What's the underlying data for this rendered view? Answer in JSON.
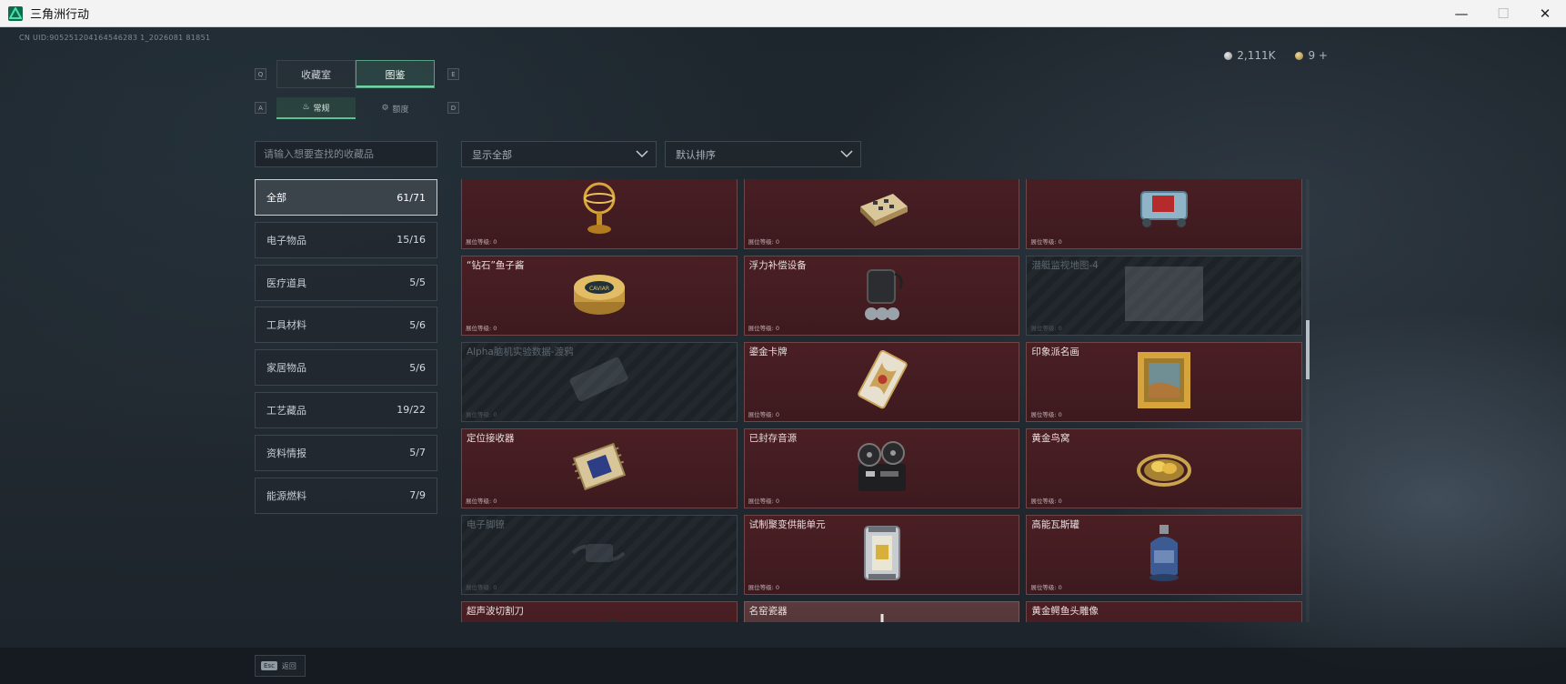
{
  "window": {
    "title": "三角洲行动",
    "minimize": "—",
    "maximize": "☐",
    "close": "✕"
  },
  "header": {
    "uid": "CN UID:905251204164546283 1_2026081 81851"
  },
  "currency": [
    {
      "icon": "silver-coin-icon",
      "value": "2,111K"
    },
    {
      "icon": "gold-coin-icon",
      "value": "9 +"
    }
  ],
  "tabs": {
    "key_left": "Q",
    "key_right": "E",
    "items": [
      {
        "label": "收藏室"
      },
      {
        "label": "图鉴",
        "active": true
      }
    ],
    "sub_key_left": "A",
    "sub_key_right": "D",
    "sub_items": [
      {
        "label": "常规",
        "active": true
      },
      {
        "label": "额度"
      }
    ]
  },
  "search": {
    "placeholder": "请输入想要查找的收藏品"
  },
  "filters": {
    "show": "显示全部",
    "sort": "默认排序"
  },
  "categories": [
    {
      "label": "全部",
      "count": "61/71",
      "active": true
    },
    {
      "label": "电子物品",
      "count": "15/16"
    },
    {
      "label": "医疗道具",
      "count": "5/5"
    },
    {
      "label": "工具材料",
      "count": "5/6"
    },
    {
      "label": "家居物品",
      "count": "5/6"
    },
    {
      "label": "工艺藏品",
      "count": "19/22"
    },
    {
      "label": "资料情报",
      "count": "5/7"
    },
    {
      "label": "能源燃料",
      "count": "7/9"
    }
  ],
  "items": [
    {
      "name": "",
      "level": "展位等级: 0",
      "icon": "gold-globe-trophy-icon",
      "locked": false
    },
    {
      "name": "",
      "level": "展位等级: 0",
      "icon": "chess-set-icon",
      "locked": false
    },
    {
      "name": "",
      "level": "展位等级: 0",
      "icon": "machine-device-icon",
      "locked": false
    },
    {
      "name": "“钻石”鱼子酱",
      "level": "展位等级: 0",
      "icon": "caviar-tin-icon",
      "locked": false
    },
    {
      "name": "浮力补偿设备",
      "level": "展位等级: 0",
      "icon": "buoyancy-device-icon",
      "locked": false
    },
    {
      "name": "潜艇监视地图-4",
      "level": "展位等级: 0",
      "icon": "map-icon",
      "locked": true
    },
    {
      "name": "Alpha脑机实验数据-渡鸦",
      "level": "展位等级: 0",
      "icon": "data-drive-icon",
      "locked": true
    },
    {
      "name": "鎏金卡牌",
      "level": "展位等级: 0",
      "icon": "gold-card-icon",
      "locked": false
    },
    {
      "name": "印象派名画",
      "level": "展位等级: 0",
      "icon": "framed-painting-icon",
      "locked": false
    },
    {
      "name": "定位接收器",
      "level": "展位等级: 0",
      "icon": "receiver-chip-icon",
      "locked": false
    },
    {
      "name": "已封存音源",
      "level": "展位等级: 0",
      "icon": "reel-recorder-icon",
      "locked": false
    },
    {
      "name": "黄金鸟窝",
      "level": "展位等级: 0",
      "icon": "golden-nest-icon",
      "locked": false
    },
    {
      "name": "电子脚镣",
      "level": "展位等级: 0",
      "icon": "ankle-monitor-icon",
      "locked": true
    },
    {
      "name": "试制聚变供能单元",
      "level": "展位等级: 0",
      "icon": "fusion-cell-icon",
      "locked": false
    },
    {
      "name": "高能瓦斯罐",
      "level": "展位等级: 0",
      "icon": "gas-canister-icon",
      "locked": false
    },
    {
      "name": "超声波切割刀",
      "level": "",
      "icon": "ultrasonic-cutter-icon",
      "locked": false
    },
    {
      "name": "名窑瓷器",
      "level": "",
      "icon": "porcelain-icon",
      "locked": false,
      "plain": true
    },
    {
      "name": "黄金鳄鱼头雕像",
      "level": "",
      "icon": "gold-croc-statue-icon",
      "locked": false
    }
  ],
  "footer": {
    "key": "Esc",
    "label": "返回"
  }
}
